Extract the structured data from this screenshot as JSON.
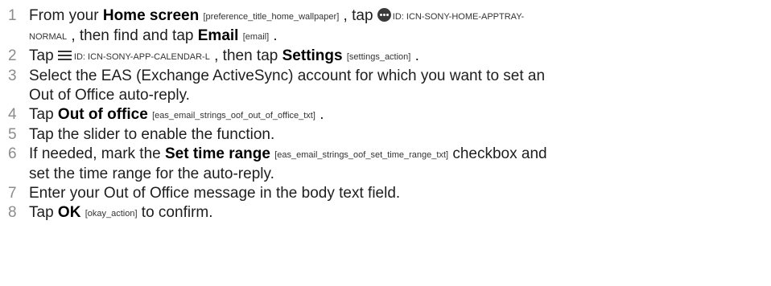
{
  "steps": [
    {
      "num": "1",
      "t1": "From your ",
      "b1": "Home screen",
      "tag1": "[preference_title_home_wallpaper]",
      "t2": " , tap ",
      "icon_id_a": "ID: ICN-SONY-HOME-APPTRAY-",
      "icon_id_b": "NORMAL",
      "t3": " , then find and tap ",
      "b2": "Email",
      "tag2": "[email]",
      "t4": " ."
    },
    {
      "num": "2",
      "t1": "Tap ",
      "icon_id": "ID: ICN-SONY-APP-CALENDAR-L",
      "t2": " , then tap ",
      "b1": "Settings",
      "tag1": "[settings_action]",
      "t3": " ."
    },
    {
      "num": "3",
      "line1": "Select the EAS (Exchange ActiveSync) account for which you want to set an",
      "line2": "Out of Office auto-reply."
    },
    {
      "num": "4",
      "t1": "Tap ",
      "b1": "Out of office",
      "tag1": "[eas_email_strings_oof_out_of_office_txt]",
      "t2": " ."
    },
    {
      "num": "5",
      "text": "Tap the slider to enable the function."
    },
    {
      "num": "6",
      "t1": "If needed, mark the ",
      "b1": "Set time range",
      "tag1": "[eas_email_strings_oof_set_time_range_txt]",
      "t2": " checkbox and",
      "line2": "set the time range for the auto-reply."
    },
    {
      "num": "7",
      "text": "Enter your Out of Office message in the body text field."
    },
    {
      "num": "8",
      "t1": "Tap ",
      "b1": "OK",
      "tag1": "[okay_action]",
      "t2": " to confirm."
    }
  ],
  "icons": {
    "step1": "apptray-icon",
    "step2": "menu-icon"
  }
}
